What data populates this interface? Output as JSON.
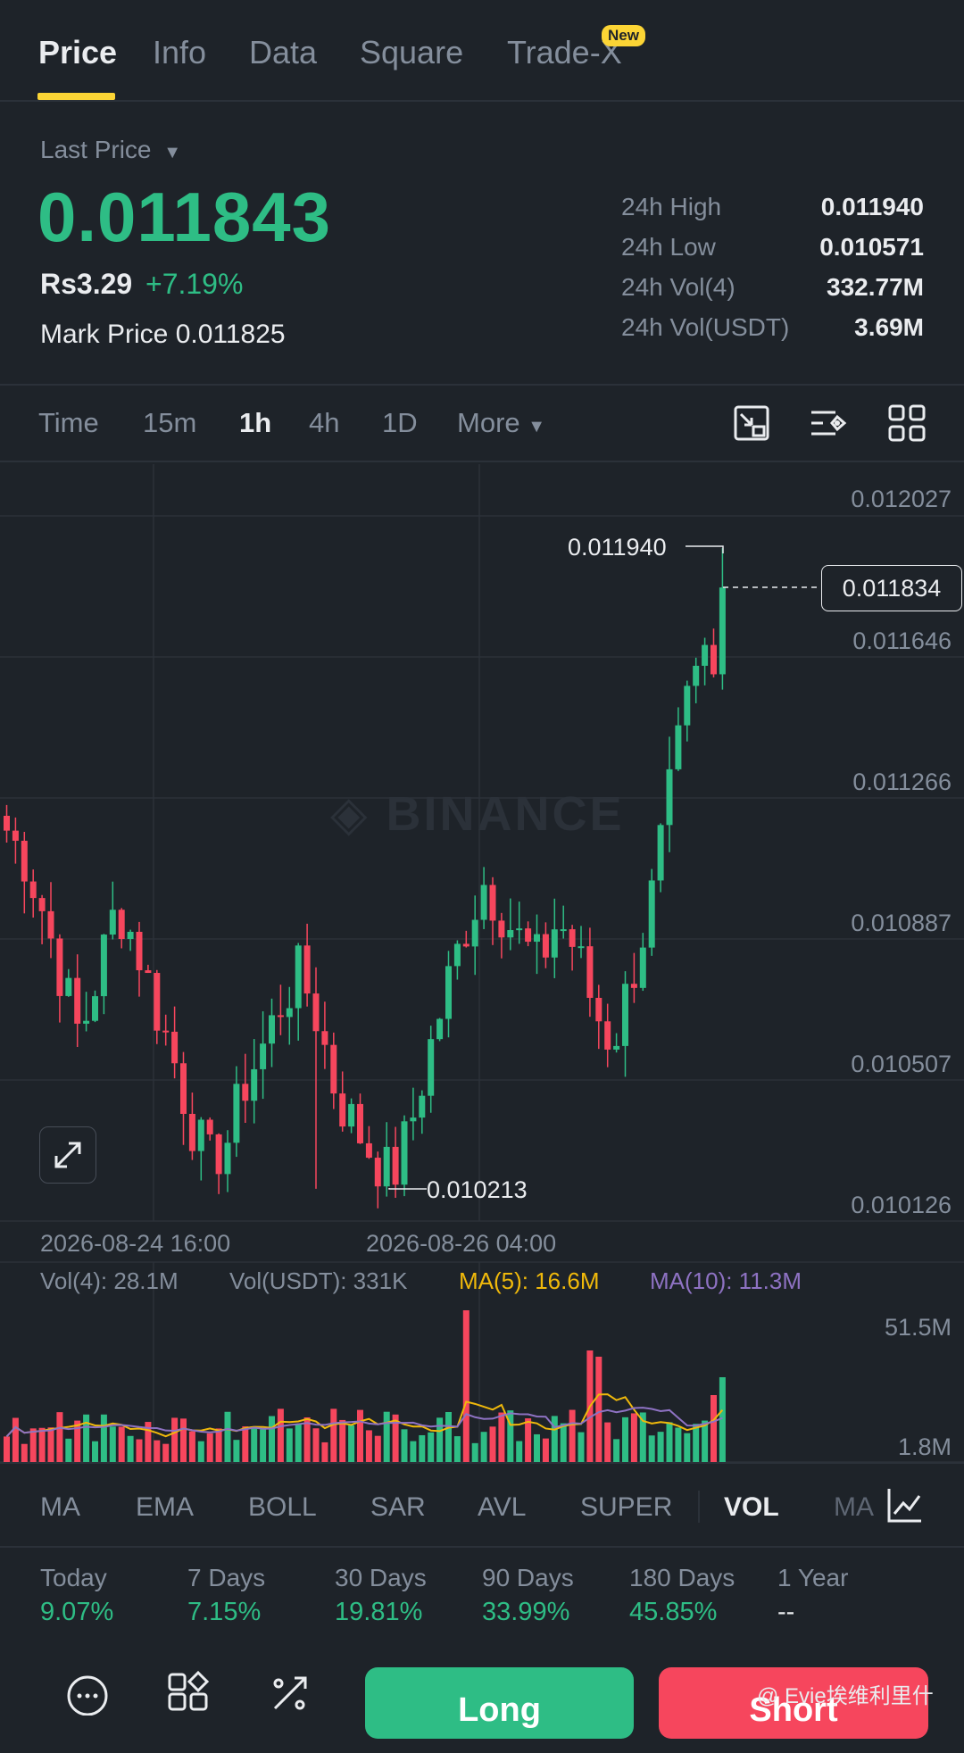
{
  "tabs": [
    {
      "label": "Price",
      "active": true
    },
    {
      "label": "Info"
    },
    {
      "label": "Data"
    },
    {
      "label": "Square"
    },
    {
      "label": "Trade-X",
      "badge": "New"
    }
  ],
  "ticker": {
    "last_price_label": "Last Price",
    "last_price": "0.011843",
    "fiat_price": "Rs3.29",
    "change_pct": "+7.19%",
    "mark_price_label": "Mark Price",
    "mark_price": "0.011825",
    "stats": [
      {
        "label": "24h High",
        "value": "0.011940"
      },
      {
        "label": "24h Low",
        "value": "0.010571"
      },
      {
        "label": "24h Vol(4)",
        "value": "332.77M"
      },
      {
        "label": "24h Vol(USDT)",
        "value": "3.69M"
      }
    ]
  },
  "intervals": [
    {
      "label": "Time"
    },
    {
      "label": "15m"
    },
    {
      "label": "1h",
      "active": true
    },
    {
      "label": "4h"
    },
    {
      "label": "1D"
    },
    {
      "label": "More"
    }
  ],
  "toolbar_icons": [
    "chart-type-icon",
    "settings-icon",
    "grid-layout-icon"
  ],
  "chart": {
    "watermark": "BINANCE",
    "price_axis": [
      "0.012027",
      "0.011646",
      "0.011266",
      "0.010887",
      "0.010507",
      "0.010126"
    ],
    "current_price": "0.011834",
    "high_marker": "0.011940",
    "low_marker": "0.010213",
    "dates": [
      "2026-08-24 16:00",
      "2026-08-26 04:00"
    ],
    "colors": {
      "up": "#2ebd85",
      "down": "#f6465d",
      "ma5": "#f0b90b",
      "ma10": "#8e72c3"
    }
  },
  "chart_data": {
    "type": "candlestick",
    "ylim": [
      0.010126,
      0.012027
    ],
    "candles_approx_close": [
      0.01118,
      0.0111,
      0.01096,
      0.01078,
      0.01062,
      0.0108,
      0.01098,
      0.01088,
      0.01072,
      0.01058,
      0.0104,
      0.01028,
      0.01034,
      0.0105,
      0.0106,
      0.01072,
      0.0108,
      0.01066,
      0.01046,
      0.01038,
      0.0103,
      0.01024,
      0.01038,
      0.01058,
      0.01076,
      0.01092,
      0.01104,
      0.01096,
      0.01088,
      0.01082,
      0.01094,
      0.01086,
      0.0107,
      0.0106,
      0.01078,
      0.01096,
      0.01124,
      0.0115,
      0.01165,
      0.01183
    ]
  },
  "volume": {
    "vol4": "Vol(4): 28.1M",
    "volusdt": "Vol(USDT): 331K",
    "ma5": "MA(5): 16.6M",
    "ma10": "MA(10): 11.3M",
    "axis_top": "51.5M",
    "axis_bottom": "1.8M"
  },
  "indicators": [
    {
      "label": "MA"
    },
    {
      "label": "EMA"
    },
    {
      "label": "BOLL"
    },
    {
      "label": "SAR"
    },
    {
      "label": "AVL"
    },
    {
      "label": "SUPER"
    },
    {
      "label": "VOL",
      "active": true
    },
    {
      "label": "MA"
    }
  ],
  "performance": [
    {
      "period": "Today",
      "value": "9.07%"
    },
    {
      "period": "7 Days",
      "value": "7.15%"
    },
    {
      "period": "30 Days",
      "value": "19.81%"
    },
    {
      "period": "90 Days",
      "value": "33.99%"
    },
    {
      "period": "180 Days",
      "value": "45.85%"
    },
    {
      "period": "1 Year",
      "value": "--"
    }
  ],
  "actions": {
    "long": "Long",
    "short": "Short",
    "credit": "@ Evie埃维利里什"
  }
}
